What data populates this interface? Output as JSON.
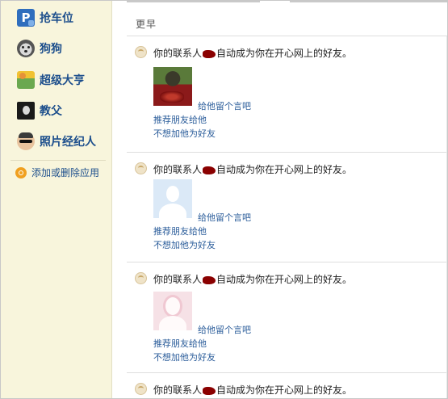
{
  "sidebar": {
    "apps": [
      {
        "label": "抢车位",
        "icon": "parking-icon"
      },
      {
        "label": "狗狗",
        "icon": "dog-icon"
      },
      {
        "label": "超级大亨",
        "icon": "money-icon"
      },
      {
        "label": "教父",
        "icon": "godfather-icon"
      },
      {
        "label": "照片经纪人",
        "icon": "agent-icon"
      }
    ],
    "manage_label": "添加或删除应用"
  },
  "main": {
    "section_title": "更早",
    "feed": [
      {
        "text_before": "你的联系人",
        "text_after": "自动成为你在开心网上的好友。",
        "avatar": "photo",
        "message_link": "给他留个言吧",
        "recommend_link": "推荐朋友给他",
        "unfriend_link": "不想加他为好友"
      },
      {
        "text_before": "你的联系人",
        "text_after": "自动成为你在开心网上的好友。",
        "avatar": "default-male",
        "message_link": "给他留个言吧",
        "recommend_link": "推荐朋友给他",
        "unfriend_link": "不想加他为好友"
      },
      {
        "text_before": "你的联系人",
        "text_after": "自动成为你在开心网上的好友。",
        "avatar": "default-female",
        "message_link": "给他留个言吧",
        "recommend_link": "推荐朋友给他",
        "unfriend_link": "不想加他为好友"
      },
      {
        "text_before": "你的联系人",
        "text_after": "自动成为你在开心网上的好友。"
      }
    ]
  },
  "colors": {
    "sidebar_bg": "#f8f5dc",
    "link": "#2a5c9a",
    "app_label": "#1c4e8c",
    "redaction": "#8a0000"
  }
}
